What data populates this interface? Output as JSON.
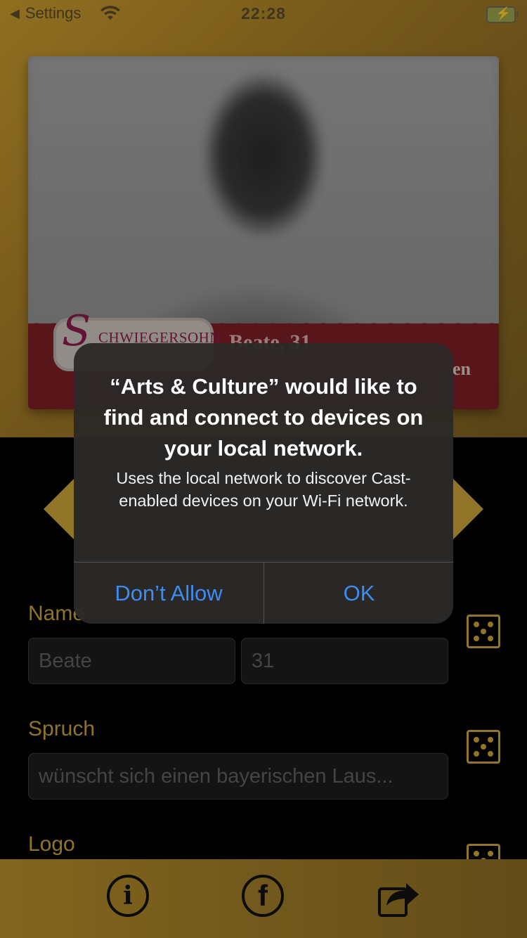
{
  "status_bar": {
    "back_label": "Settings",
    "time": "22:28"
  },
  "card": {
    "logo_text": "CHWIEGERSOHN",
    "logo_initial": "S",
    "name_age": "Beate, 31",
    "caption_fragment": "en"
  },
  "form": {
    "name_label": "Name",
    "name_value": "Beate",
    "age_value": "31",
    "spruch_label": "Spruch",
    "spruch_value": "wünscht sich einen bayerischen Laus...",
    "logo_label": "Logo"
  },
  "toolbar": {
    "info_glyph": "i",
    "facebook_glyph": "f"
  },
  "alert": {
    "title": "“Arts & Culture” would like to find and connect to devices on your local network.",
    "message": "Uses the local network to discover Cast-enabled devices on your Wi-Fi network.",
    "deny_label": "Don’t Allow",
    "ok_label": "OK"
  },
  "colors": {
    "accent_gold": "#c9a23a",
    "alert_button_blue": "#3e8cf2"
  }
}
